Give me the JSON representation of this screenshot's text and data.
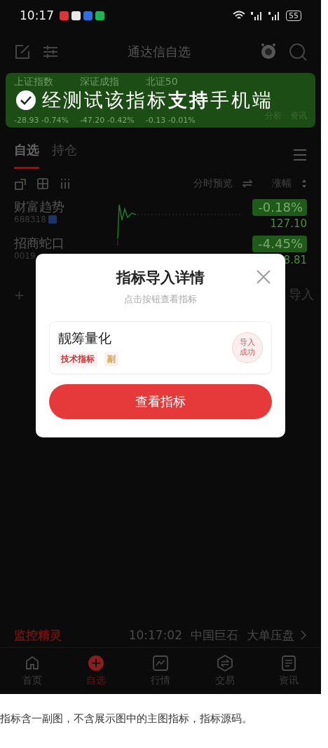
{
  "status_bar": {
    "time": "10:17",
    "battery": "55"
  },
  "header": {
    "title": "通达信自选"
  },
  "index_strip": {
    "items": [
      {
        "name": "上证指数",
        "change": "-28.93 -0.74%"
      },
      {
        "name": "深证成指",
        "change": "-47.20 -0.42%"
      },
      {
        "name": "北证50",
        "change": "-0.13 -0.01%"
      }
    ],
    "actions": [
      "分析",
      "资讯"
    ]
  },
  "banner": {
    "text": "经测试该指标**支持**手机端"
  },
  "tabs": [
    {
      "label": "自选",
      "selected": true
    },
    {
      "label": "持仓",
      "selected": false
    }
  ],
  "list_header": {
    "preview": "分时预览",
    "sort": "涨幅"
  },
  "rows": [
    {
      "name": "财富趋势",
      "code": "688318",
      "change": "-0.18%",
      "price": "127.10"
    },
    {
      "name": "招商蛇口",
      "code": "0019",
      "change": "-4.45%",
      "price": "8.81"
    }
  ],
  "add_row": {
    "plus": "+",
    "import": "导入"
  },
  "modal": {
    "title": "指标导入详情",
    "subtitle": "点击按钮查看指标",
    "indicator": {
      "name": "靓筹量化",
      "tags": [
        {
          "label": "技术指标",
          "color": "#c8343a"
        },
        {
          "label": "副",
          "color": "#d99a3a"
        }
      ],
      "stamp": "导入成功"
    },
    "button": "查看指标"
  },
  "monitor": {
    "label": "监控精灵",
    "time": "10:17:02",
    "stock": "中国巨石",
    "event": "大单压盘"
  },
  "nav": [
    {
      "label": "首页",
      "selected": false
    },
    {
      "label": "自选",
      "selected": true
    },
    {
      "label": "行情",
      "selected": false
    },
    {
      "label": "交易",
      "selected": false
    },
    {
      "label": "资讯",
      "selected": false
    }
  ],
  "caption": "指标含一副图，不含展示图中的主图指标，指标源码。"
}
